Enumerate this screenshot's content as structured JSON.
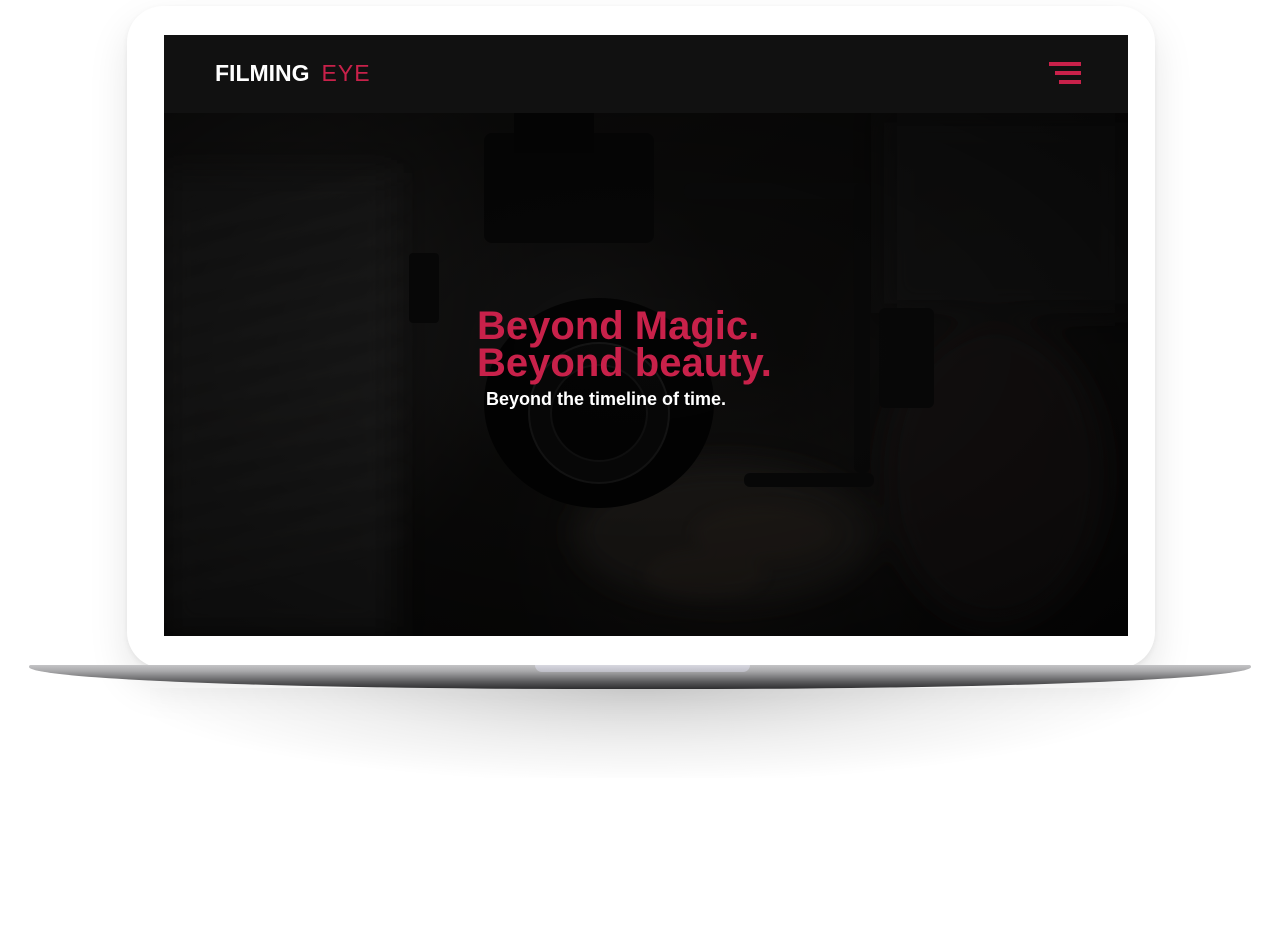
{
  "brand": {
    "name_main": "FILMING",
    "name_accent": "EYE",
    "accent_color": "#c8214a"
  },
  "navbar": {
    "menu_icon": "hamburger-menu-icon"
  },
  "hero": {
    "title_line1": "Beyond Magic.",
    "title_line2": "Beyond beauty.",
    "subtitle": "Beyond the timeline of time.",
    "background_image": "dark photo of a hand holding a video camera"
  }
}
